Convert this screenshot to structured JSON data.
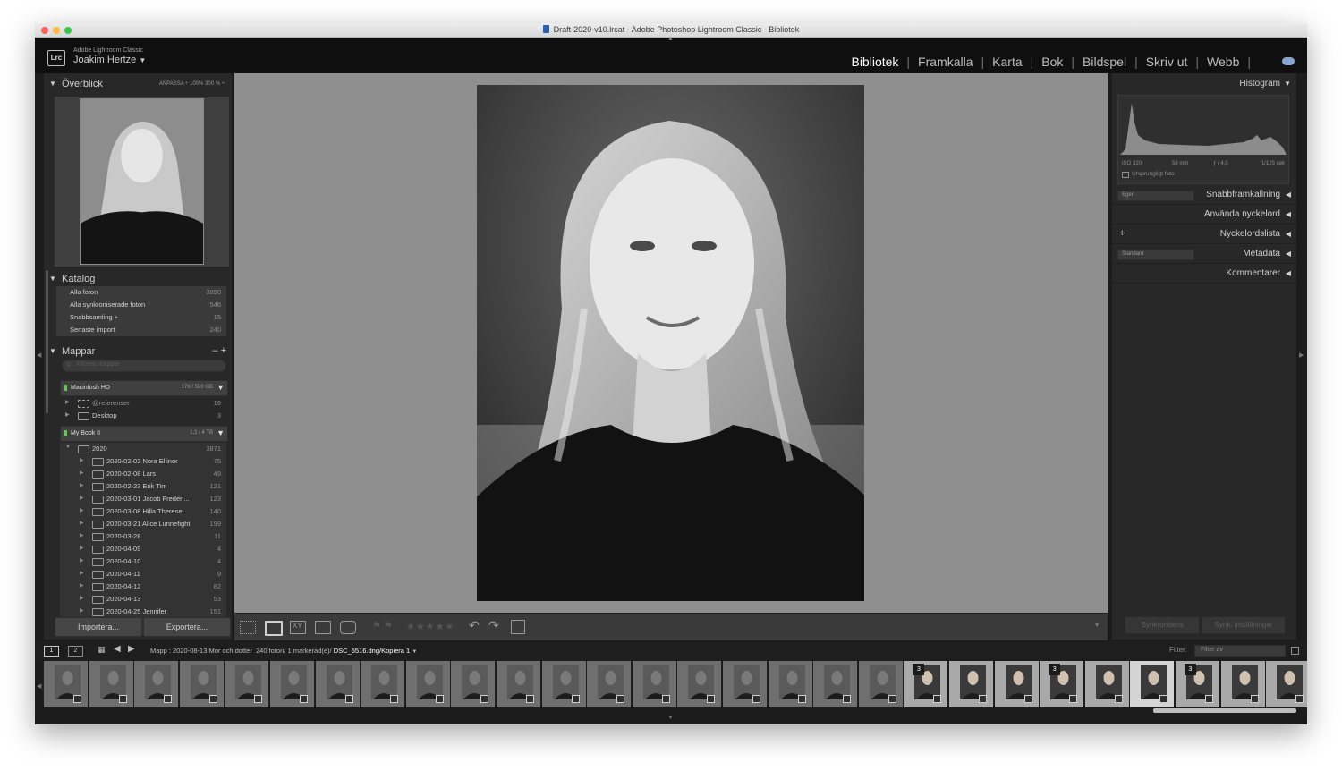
{
  "window_title": "Draft-2020-v10.lrcat - Adobe Photoshop Lightroom Classic - Bibliotek",
  "identity": {
    "logo": "Lrc",
    "product": "Adobe Lightroom Classic",
    "user": "Joakim Hertze",
    "user_menu_arrow": "▼"
  },
  "modules": [
    {
      "label": "Bibliotek",
      "active": true
    },
    {
      "label": "Framkalla",
      "active": false
    },
    {
      "label": "Karta",
      "active": false
    },
    {
      "label": "Bok",
      "active": false
    },
    {
      "label": "Bildspel",
      "active": false
    },
    {
      "label": "Skriv ut",
      "active": false
    },
    {
      "label": "Webb",
      "active": false
    }
  ],
  "left_panel": {
    "overview": {
      "title": "Överblick",
      "options": "ANPASSA ÷   100%   300 % ÷"
    },
    "catalog": {
      "title": "Katalog",
      "items": [
        {
          "label": "Alla foton",
          "count": "3890"
        },
        {
          "label": "Alla synkroniserade foton",
          "count": "546"
        },
        {
          "label": "Snabbsamling +",
          "count": "15"
        },
        {
          "label": "Senaste import",
          "count": "240"
        }
      ]
    },
    "folders": {
      "title": "Mappar",
      "actions": "–  +",
      "search_placeholder": "Filtrera mappar",
      "volumes": [
        {
          "name": "Macintosh HD",
          "capacity": "176 / 500 GB"
        },
        {
          "name": "My Book II",
          "capacity": "1,1 / 4 TB"
        }
      ],
      "hd_items": [
        {
          "label": "@referenser",
          "count": "16"
        },
        {
          "label": "Desktop",
          "count": "3"
        }
      ],
      "year": {
        "label": "2020",
        "count": "3871"
      },
      "subfolders": [
        {
          "label": "2020-02-02 Nora Ellinor",
          "count": "75"
        },
        {
          "label": "2020-02-08 Lars",
          "count": "49"
        },
        {
          "label": "2020-02-23 Erik Tim",
          "count": "121"
        },
        {
          "label": "2020-03-01 Jacob Frederi...",
          "count": "123"
        },
        {
          "label": "2020-03-08 Hilla Therese",
          "count": "140"
        },
        {
          "label": "2020-03-21 Alice Lunnefight",
          "count": "199"
        },
        {
          "label": "2020-03-28",
          "count": "11"
        },
        {
          "label": "2020-04-09",
          "count": "4"
        },
        {
          "label": "2020-04-10",
          "count": "4"
        },
        {
          "label": "2020-04-11",
          "count": "9"
        },
        {
          "label": "2020-04-12",
          "count": "82"
        },
        {
          "label": "2020-04-13",
          "count": "53"
        },
        {
          "label": "2020-04-25 Jennifer",
          "count": "151"
        }
      ]
    },
    "import_button": "Importera...",
    "export_button": "Exportera..."
  },
  "right_panel": {
    "histogram": {
      "title": "Histogram",
      "iso": "ISO 320",
      "focal": "58 mm",
      "aperture": "ƒ / 4,0",
      "shutter": "1/125 sek",
      "original_label": "Ursprungligt foto"
    },
    "sections": [
      {
        "label": "Snabbframkallning",
        "select": "Egen"
      },
      {
        "label": "Använda nyckelord"
      },
      {
        "label": "Nyckelordslista",
        "plus": "+"
      },
      {
        "label": "Metadata",
        "select": "Standard"
      },
      {
        "label": "Kommentarer"
      }
    ],
    "sync_button": "Synkronisera",
    "sync_settings_button": "Synk. inställningar"
  },
  "toolbar": {
    "stars": "★★★★★"
  },
  "filmstrip_bar": {
    "screen1": "1",
    "screen2": "2",
    "path": "Mapp : 2020-08-13 Mor och dotter",
    "counts": "240 foton/ 1 markerad(e)/",
    "filename": "DSC_5516.dng/Kopiera 1",
    "filter_label": "Filter:",
    "filter_value": "Filter av"
  },
  "filmstrip": {
    "cells": [
      {
        "num": "",
        "dim": true
      },
      {
        "num": "",
        "dim": true
      },
      {
        "num": "",
        "dim": true
      },
      {
        "num": "",
        "dim": true
      },
      {
        "num": "",
        "dim": true
      },
      {
        "num": "",
        "dim": true
      },
      {
        "num": "",
        "dim": true
      },
      {
        "num": "",
        "dim": true
      },
      {
        "num": "",
        "dim": true
      },
      {
        "num": "",
        "dim": true
      },
      {
        "num": "",
        "dim": true
      },
      {
        "num": "",
        "dim": true
      },
      {
        "num": "",
        "dim": true
      },
      {
        "num": "",
        "dim": true
      },
      {
        "num": "",
        "dim": true
      },
      {
        "num": "",
        "dim": true
      },
      {
        "num": "",
        "dim": true
      },
      {
        "num": "",
        "dim": true
      },
      {
        "num": "",
        "dim": true
      },
      {
        "num": "3",
        "dim": false
      },
      {
        "num": "",
        "dim": false
      },
      {
        "num": "",
        "dim": false
      },
      {
        "num": "3",
        "dim": false
      },
      {
        "num": "",
        "dim": false
      },
      {
        "num": "",
        "dim": false,
        "selected": true
      },
      {
        "num": "3",
        "dim": false
      },
      {
        "num": "",
        "dim": false
      },
      {
        "num": "",
        "dim": false
      }
    ]
  }
}
